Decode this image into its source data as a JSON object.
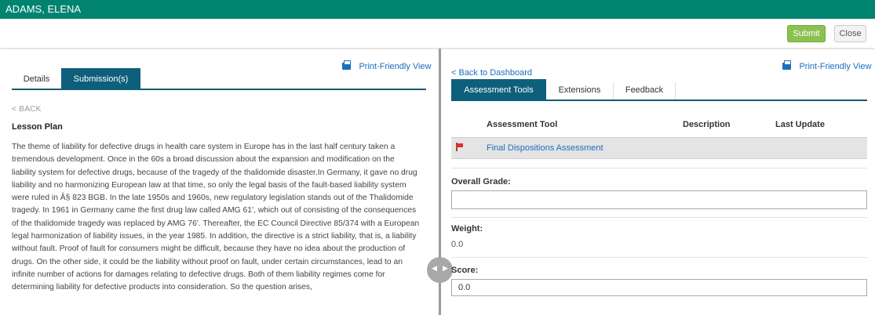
{
  "header": {
    "student_name": "ADAMS, ELENA"
  },
  "actions": {
    "submit": "Submit",
    "close": "Close"
  },
  "left": {
    "print_friendly": "Print-Friendly View",
    "tabs": [
      {
        "label": "Details"
      },
      {
        "label": "Submission(s)"
      }
    ],
    "back": "< BACK",
    "lesson_title": "Lesson Plan",
    "lesson_text": "The theme of liability for defective drugs in health care system in Europe has in the last half century taken a tremendous development. Once in the 60s a broad discussion about the expansion and modification on the liability system for defective drugs, because of the tragedy of the thalidomide disaster.In Germany, it gave no drug liability and no harmonizing European law at that time, so only the legal basis of the fault-based liability system were ruled in Â§ 823 BGB. In the late 1950s and 1960s, new regulatory legislation stands out of the Thalidomide tragedy. In 1961 in Germany came the first drug law called AMG 61', which out of consisting of the consequences of the thalidomide tragedy was replaced by AMG 76'. Thereafter, the EC Council Directive 85/374 with a European legal harmonization of liability issues, in the year 1985. In addition, the directive is a strict liability, that is, a liability without fault. Proof of fault for consumers might be difficult, because they have no idea about the production of drugs. On the other side, it could be the liability without proof on fault, under certain circumstances, lead to an infinite number of actions for damages relating to defective drugs. Both of them liability regimes come for determining liability for defective products into consideration. So the question arises,"
  },
  "right": {
    "print_friendly": "Print-Friendly View",
    "back_to_dashboard": "< Back to Dashboard",
    "tabs": [
      {
        "label": "Assessment Tools"
      },
      {
        "label": "Extensions"
      },
      {
        "label": "Feedback"
      }
    ],
    "table": {
      "headers": {
        "tool": "Assessment Tool",
        "description": "Description",
        "last_update": "Last Update"
      },
      "rows": [
        {
          "tool": "Final Dispositions Assessment",
          "description": "",
          "last_update": ""
        }
      ]
    },
    "overall_grade": {
      "label": "Overall Grade:",
      "value": ""
    },
    "weight": {
      "label": "Weight:",
      "value": "0.0"
    },
    "score": {
      "label": "Score:",
      "value": "0.0"
    }
  },
  "icons": {
    "print": "printer-icon",
    "flag": "flag-icon",
    "splitter": "splitter-arrows-icon"
  },
  "colors": {
    "header_bg": "#00836f",
    "tab_active": "#0d5f7c",
    "submit_bg": "#8cc152",
    "link": "#1a6fc0"
  }
}
